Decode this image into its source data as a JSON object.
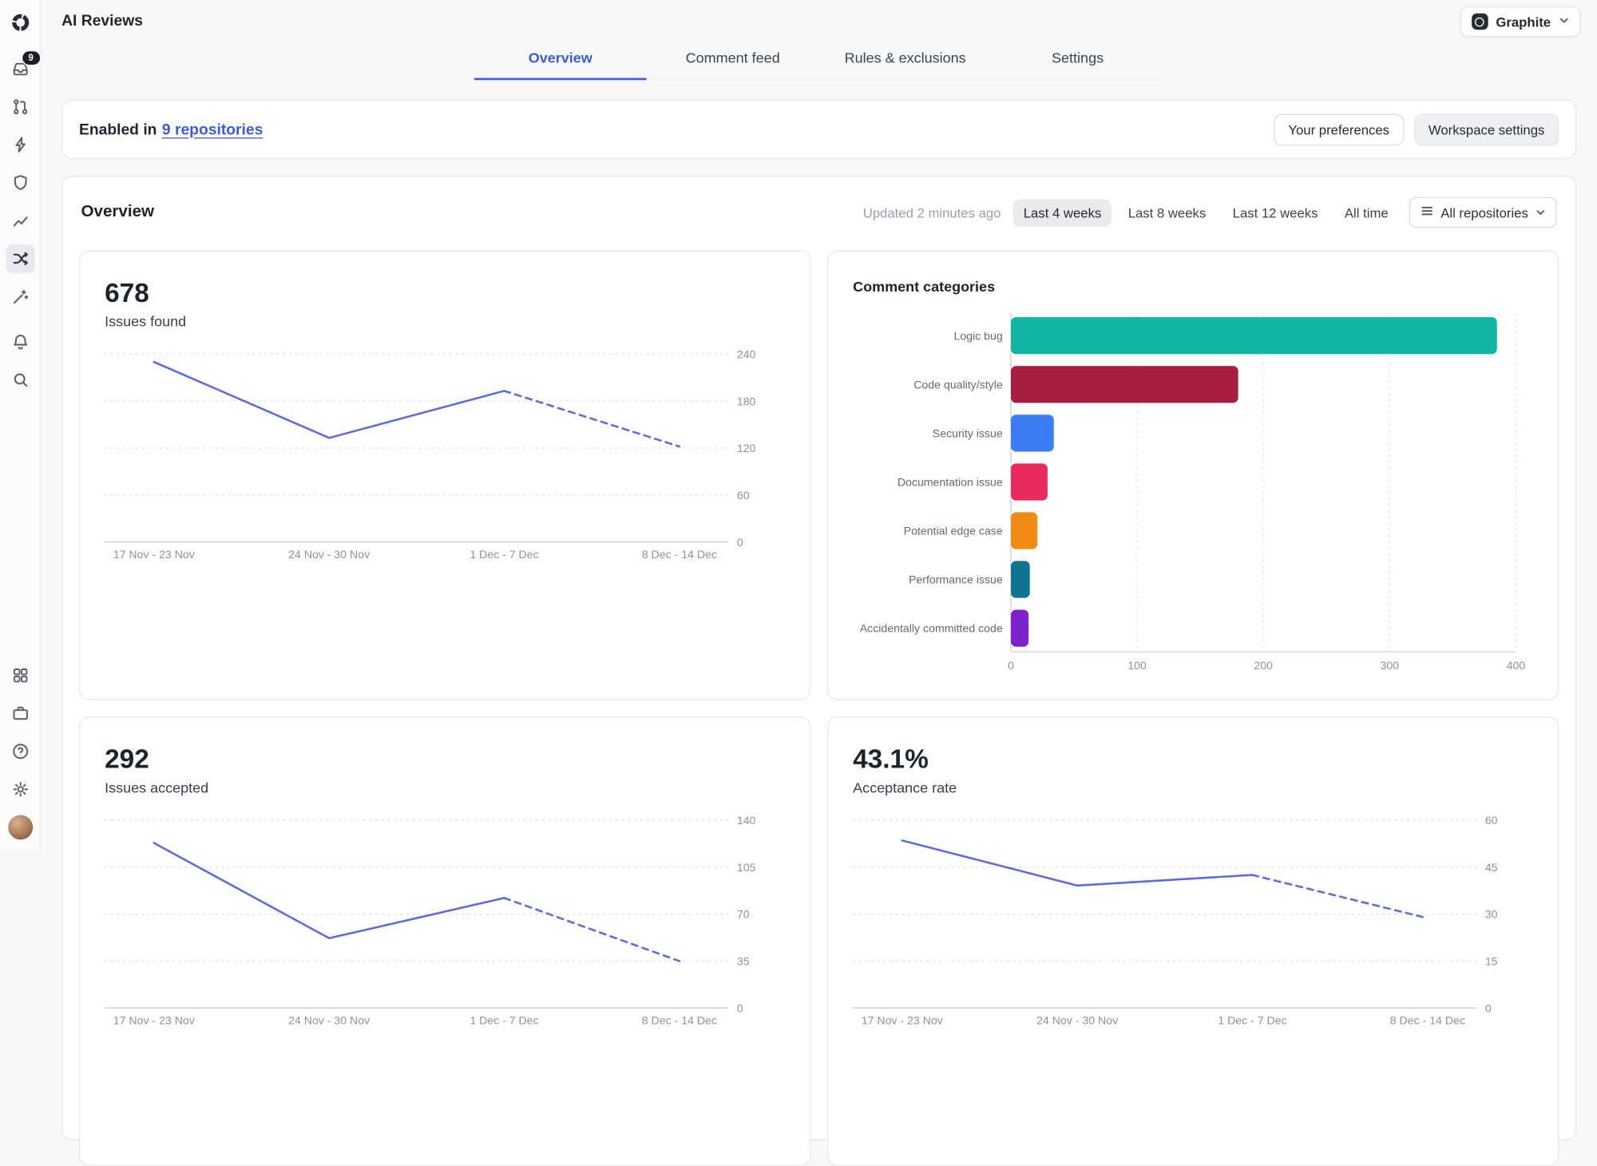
{
  "app": {
    "title": "AI Reviews",
    "workspace_switcher": {
      "label": "Graphite"
    }
  },
  "sidebar": {
    "inbox_badge": "9",
    "icons": [
      "graphite-logo-icon",
      "inbox-icon",
      "pull-request-icon",
      "lightning-icon",
      "shield-icon",
      "line-chart-icon",
      "shuffle-icon",
      "magic-wand-icon",
      "bell-icon",
      "search-icon",
      "grid-icon",
      "briefcase-icon",
      "help-icon",
      "gear-icon",
      "user-avatar"
    ],
    "active_item": "ai-reviews"
  },
  "tabs": [
    {
      "label": "Overview",
      "active": true
    },
    {
      "label": "Comment feed",
      "active": false
    },
    {
      "label": "Rules & exclusions",
      "active": false
    },
    {
      "label": "Settings",
      "active": false
    }
  ],
  "banner": {
    "text_prefix": "Enabled in",
    "link_text": "9 repositories",
    "preferences_button": "Your preferences",
    "workspace_settings_button": "Workspace settings"
  },
  "overview": {
    "title": "Overview",
    "updated_text": "Updated 2 minutes ago",
    "range_buttons": [
      {
        "label": "Last 4 weeks",
        "active": true
      },
      {
        "label": "Last 8 weeks",
        "active": false
      },
      {
        "label": "Last 12 weeks",
        "active": false
      },
      {
        "label": "All time",
        "active": false
      }
    ],
    "repository_filter": {
      "label": "All repositories"
    }
  },
  "stats": {
    "issues_found": {
      "value": "678",
      "label": "Issues found"
    },
    "issues_accepted": {
      "value": "292",
      "label": "Issues accepted"
    },
    "acceptance_rate": {
      "value": "43.1%",
      "label": "Acceptance rate"
    }
  },
  "colors": {
    "accent_blue": "#3d5bd7",
    "line_indigo": "#5b6ce0"
  },
  "chart_data": [
    {
      "id": "issues_found",
      "type": "line",
      "title": "Issues found",
      "categories": [
        "17 Nov - 23 Nov",
        "24 Nov - 30 Nov",
        "1 Dec - 7 Dec",
        "8 Dec - 14 Dec"
      ],
      "values": [
        230,
        133,
        193,
        122
      ],
      "ylim": [
        0,
        240
      ],
      "yticks": [
        0,
        60,
        120,
        180,
        240
      ],
      "dashed_from_index": 2,
      "line_color": "#5b6ce0",
      "grid": "dotted-horizontal"
    },
    {
      "id": "comment_categories",
      "type": "bar",
      "orientation": "horizontal",
      "title": "Comment categories",
      "categories": [
        "Logic bug",
        "Code quality/style",
        "Security issue",
        "Documentation issue",
        "Potential edge case",
        "Performance issue",
        "Accidentally committed code"
      ],
      "values": [
        385,
        180,
        34,
        29,
        21,
        15,
        14
      ],
      "xlim": [
        0,
        400
      ],
      "xticks": [
        0,
        100,
        200,
        300,
        400
      ],
      "bar_colors": [
        "#12b5a3",
        "#a81e41",
        "#3c7df5",
        "#e82a5c",
        "#f18b16",
        "#0e7490",
        "#7e22ce"
      ]
    },
    {
      "id": "issues_accepted",
      "type": "line",
      "title": "Issues accepted",
      "categories": [
        "17 Nov - 23 Nov",
        "24 Nov - 30 Nov",
        "1 Dec - 7 Dec",
        "8 Dec - 14 Dec"
      ],
      "values": [
        123,
        52,
        82,
        35
      ],
      "ylim": [
        0,
        140
      ],
      "yticks": [
        0,
        35,
        70,
        105,
        140
      ],
      "dashed_from_index": 2,
      "line_color": "#5b6ce0",
      "grid": "dotted-horizontal"
    },
    {
      "id": "acceptance_rate",
      "type": "line",
      "title": "Acceptance rate",
      "categories": [
        "17 Nov - 23 Nov",
        "24 Nov - 30 Nov",
        "1 Dec - 7 Dec",
        "8 Dec - 14 Dec"
      ],
      "values": [
        53.5,
        39.1,
        42.5,
        28.7
      ],
      "unit": "%",
      "ylim": [
        0,
        60
      ],
      "yticks": [
        0,
        15,
        30,
        45,
        60
      ],
      "dashed_from_index": 2,
      "line_color": "#5b6ce0",
      "grid": "dotted-horizontal"
    }
  ]
}
